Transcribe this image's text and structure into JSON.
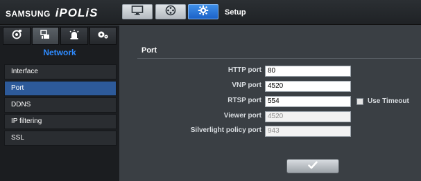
{
  "header": {
    "brand_samsung": "SAMSUNG",
    "brand_ipolis": "iPOLiS",
    "title": "Setup",
    "buttons": [
      {
        "icon": "monitor-icon",
        "active": false
      },
      {
        "icon": "film-reel-icon",
        "active": false
      },
      {
        "icon": "gear-icon",
        "active": true
      }
    ]
  },
  "sidebar": {
    "tabs": [
      {
        "icon": "camera-lens-icon",
        "active": false
      },
      {
        "icon": "network-icon",
        "active": true
      },
      {
        "icon": "alarm-icon",
        "active": false
      },
      {
        "icon": "system-gears-icon",
        "active": false
      }
    ],
    "section_title": "Network",
    "items": [
      {
        "label": "Interface",
        "selected": false
      },
      {
        "label": "Port",
        "selected": true
      },
      {
        "label": "DDNS",
        "selected": false
      },
      {
        "label": "IP filtering",
        "selected": false
      },
      {
        "label": "SSL",
        "selected": false
      }
    ]
  },
  "main": {
    "title": "Port",
    "fields": [
      {
        "label": "HTTP port",
        "value": "80",
        "disabled": false
      },
      {
        "label": "VNP port",
        "value": "4520",
        "disabled": false
      },
      {
        "label": "RTSP port",
        "value": "554",
        "disabled": false
      },
      {
        "label": "Viewer port",
        "value": "4520",
        "disabled": true
      },
      {
        "label": "Silverlight policy port",
        "value": "943",
        "disabled": true
      }
    ],
    "use_timeout_label": "Use Timeout",
    "use_timeout_checked": false
  },
  "colors": {
    "accent": "#2f8bff",
    "selected_menu": "#2d5a9a",
    "active_topbutton": "#1c62c8"
  }
}
